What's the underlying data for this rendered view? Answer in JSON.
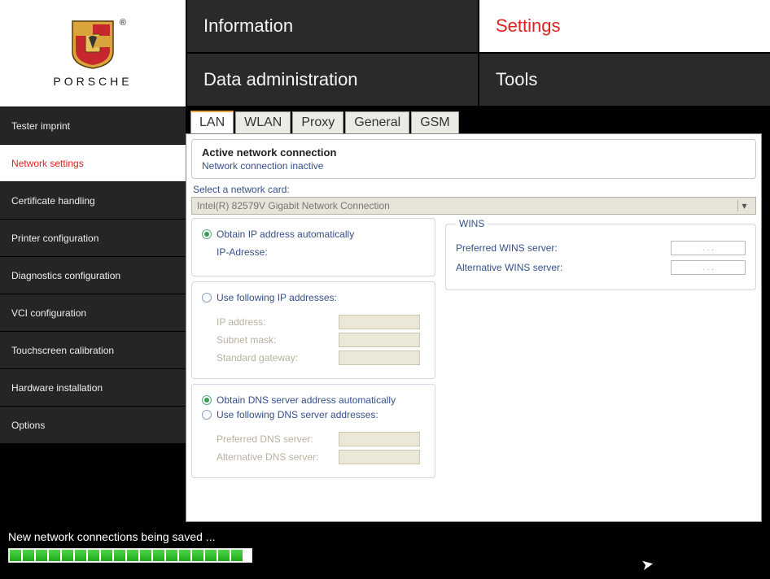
{
  "brand": "PORSCHE",
  "topnav": {
    "information": "Information",
    "settings": "Settings",
    "data_admin": "Data administration",
    "tools": "Tools"
  },
  "sidebar": {
    "items": [
      {
        "label": "Tester imprint"
      },
      {
        "label": "Network settings"
      },
      {
        "label": "Certificate handling"
      },
      {
        "label": "Printer configuration"
      },
      {
        "label": "Diagnostics configuration"
      },
      {
        "label": "VCI configuration"
      },
      {
        "label": "Touchscreen calibration"
      },
      {
        "label": "Hardware installation"
      },
      {
        "label": "Options"
      }
    ],
    "active_index": 1
  },
  "tabs": {
    "items": [
      "LAN",
      "WLAN",
      "Proxy",
      "General",
      "GSM"
    ],
    "active_index": 0
  },
  "active_conn": {
    "title": "Active network connection",
    "status": "Network connection inactive"
  },
  "netcard": {
    "select_label": "Select a network card:",
    "value": "Intel(R) 82579V Gigabit Network Connection"
  },
  "ip": {
    "auto_label": "Obtain IP address automatically",
    "ip_adresse": "IP-Adresse:",
    "manual_label": "Use following IP addresses:",
    "ip_address": "IP address:",
    "subnet": "Subnet mask:",
    "gateway": "Standard gateway:"
  },
  "dns": {
    "auto_label": "Obtain DNS server address automatically",
    "manual_label": "Use following DNS server addresses:",
    "preferred": "Preferred DNS server:",
    "alternative": "Alternative DNS server:"
  },
  "wins": {
    "legend": "WINS",
    "preferred": "Preferred WINS server:",
    "alternative": "Alternative WINS server:",
    "placeholder": ".     .     ."
  },
  "status": {
    "text": "New network connections being saved ...",
    "progress_segments": 18
  }
}
